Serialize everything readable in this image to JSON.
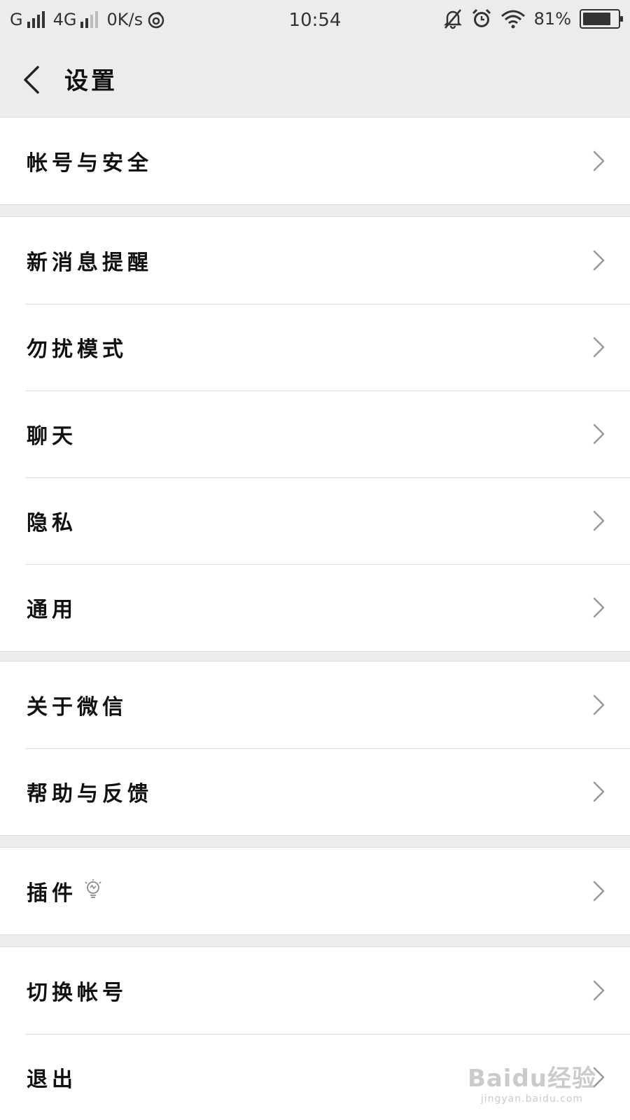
{
  "status_bar": {
    "carrier1": "G",
    "carrier2": "4G",
    "net_speed": "0K/s",
    "time": "10:54",
    "battery": "81%",
    "battery_level": 0.81,
    "icons": [
      "signal-icon",
      "netease-music-icon",
      "mute-notification-icon",
      "alarm-icon",
      "wifi-icon",
      "battery-icon"
    ]
  },
  "nav": {
    "title": "设置",
    "back_icon": "back-arrow-icon"
  },
  "settings": {
    "group1": [
      {
        "label": "帐号与安全"
      }
    ],
    "group2": [
      {
        "label": "新消息提醒"
      },
      {
        "label": "勿扰模式"
      },
      {
        "label": "聊天"
      },
      {
        "label": "隐私"
      },
      {
        "label": "通用"
      }
    ],
    "group3": [
      {
        "label": "关于微信"
      },
      {
        "label": "帮助与反馈"
      }
    ],
    "group4": [
      {
        "label": "插件",
        "icon": "lightbulb-icon"
      }
    ],
    "group5": [
      {
        "label": "切换帐号"
      },
      {
        "label": "退出"
      }
    ]
  },
  "colors": {
    "background": "#ececec",
    "list_bg": "#ffffff",
    "divider": "#dedede",
    "chevron": "#9a9a9a"
  },
  "watermark": {
    "logo": "Baidu经验",
    "url": "jingyan.baidu.com"
  }
}
